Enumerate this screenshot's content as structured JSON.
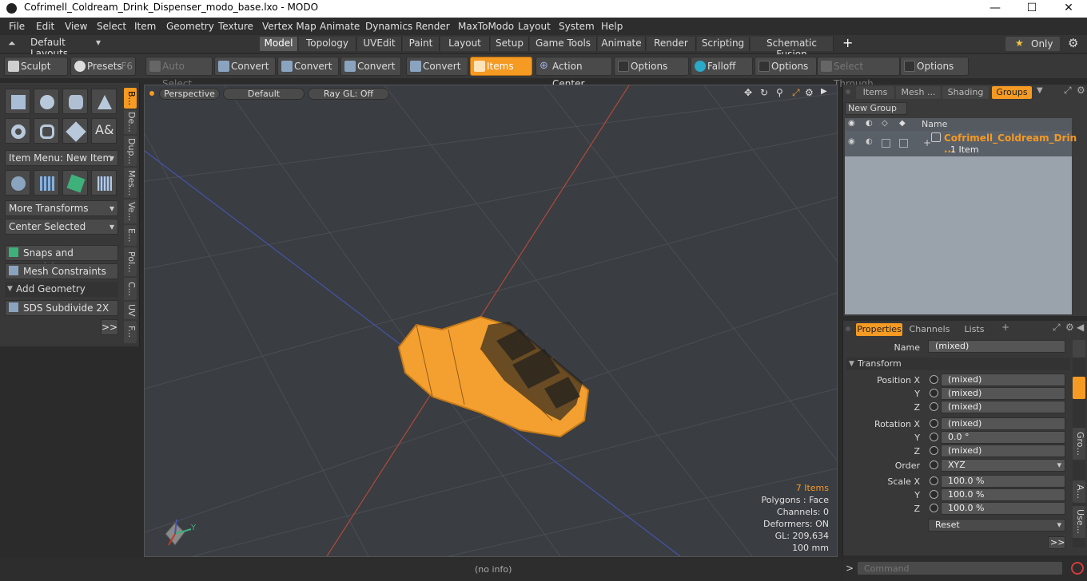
{
  "window": {
    "title": "Cofrimell_Coldream_Drink_Dispenser_modo_base.lxo - MODO",
    "minimize": "—",
    "maximize": "☐",
    "close": "✕"
  },
  "menu": [
    "File",
    "Edit",
    "View",
    "Select",
    "Item",
    "Geometry",
    "Texture",
    "Vertex Map",
    "Animate",
    "Dynamics",
    "Render",
    "MaxToModo",
    "Layout",
    "System",
    "Help"
  ],
  "layouts_label": "Default Layouts",
  "layout_tabs": [
    "Model",
    "Topology",
    "UVEdit",
    "Paint",
    "Layout",
    "Setup",
    "Game Tools",
    "Animate",
    "Render",
    "Scripting",
    "Schematic Fusion"
  ],
  "active_layout_tab": "Model",
  "only_label": "Only",
  "toolbar": {
    "sculpt": "Sculpt",
    "presets": "Presets",
    "presets_key": "F6",
    "auto_select": "Auto Select",
    "convert1": "Convert",
    "convert2": "Convert",
    "convert3": "Convert",
    "convert4": "Convert",
    "items": "Items",
    "action_center": "Action Center",
    "options1": "Options",
    "falloff": "Falloff",
    "options2": "Options",
    "select_through": "Select Through",
    "options3": "Options"
  },
  "left_panel": {
    "item_menu": "Item Menu: New Item",
    "more_transforms": "More Transforms",
    "center_selected": "Center Selected",
    "snaps": "Snaps and Precision",
    "mesh_constraints": "Mesh Constraints",
    "add_geometry": "Add Geometry",
    "sds": "SDS Subdivide 2X",
    "more": ">>",
    "vtabs": [
      "B...",
      "De...",
      "Dup...",
      "Mes...",
      "Ve...",
      "E...",
      "Pol...",
      "C...",
      "UV",
      "F..."
    ]
  },
  "viewport": {
    "perspective": "Perspective",
    "default": "Default",
    "raygl": "Ray GL: Off",
    "stats": {
      "items": "7 Items",
      "polygons": "Polygons : Face",
      "channels": "Channels: 0",
      "deformers": "Deformers: ON",
      "gl": "GL: 209,634",
      "scale": "100 mm"
    },
    "axis_y": "Y"
  },
  "status": {
    "info": "(no info)"
  },
  "groups_panel": {
    "tabs": [
      "Items",
      "Mesh ...",
      "Shading",
      "Groups"
    ],
    "active_tab": "Groups",
    "new_group": "New Group",
    "col_name": "Name",
    "row_name": "Cofrimell_Coldream_Drin ...",
    "row_count": "1 Item"
  },
  "props_panel": {
    "tabs": [
      "Properties",
      "Channels",
      "Lists"
    ],
    "active_tab": "Properties",
    "name_label": "Name",
    "name_value": "(mixed)",
    "transform": "Transform",
    "position_x_label": "Position X",
    "position_x": "(mixed)",
    "position_y": "(mixed)",
    "position_z": "(mixed)",
    "rotation_x_label": "Rotation X",
    "rotation_x": "(mixed)",
    "rotation_y": "0.0 °",
    "rotation_z": "(mixed)",
    "order_label": "Order",
    "order_value": "XYZ",
    "scale_x_label": "Scale X",
    "scale_x": "100.0 %",
    "scale_y": "100.0 %",
    "scale_z": "100.0 %",
    "y_label": "Y",
    "z_label": "Z",
    "reset": "Reset",
    "more": ">>",
    "side_tabs": [
      "Gro...",
      "A...",
      "Use..."
    ]
  },
  "command": {
    "prompt": ">",
    "placeholder": "Command"
  },
  "colors": {
    "accent": "#f59a23",
    "viewport_bg": "#3a3d42",
    "wire": "#f4a030"
  }
}
